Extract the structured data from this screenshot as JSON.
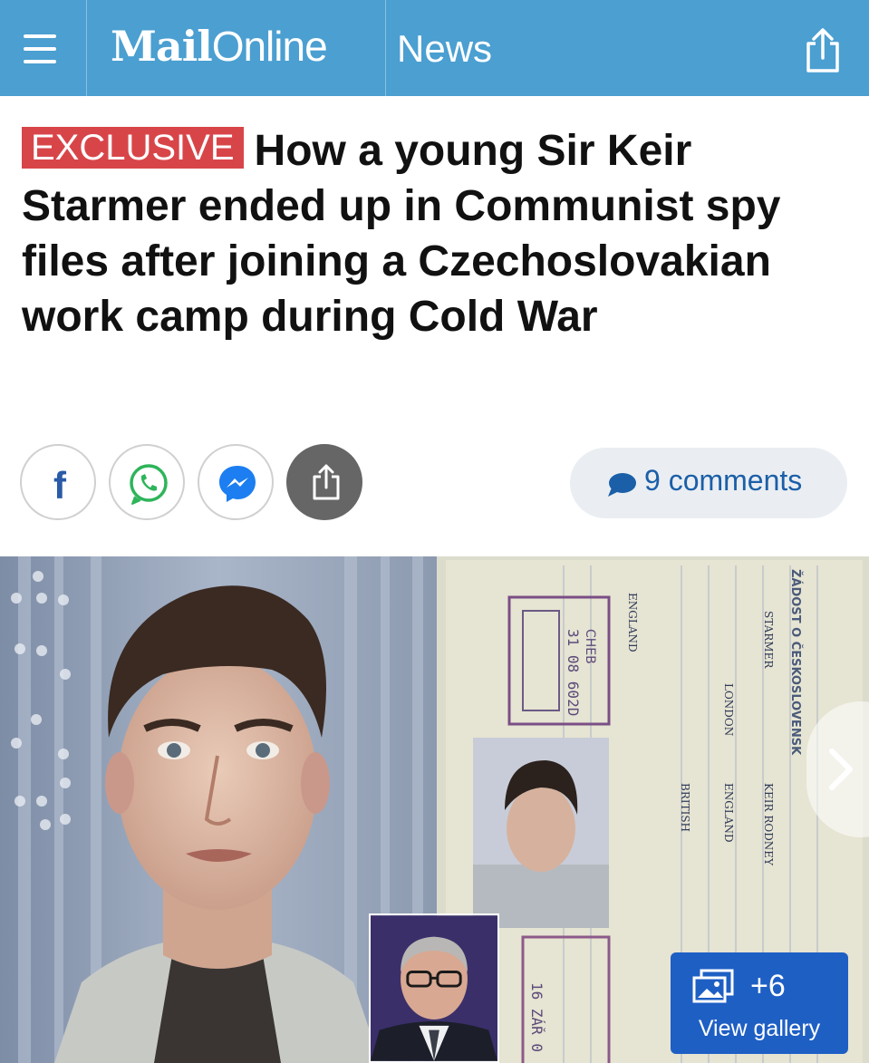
{
  "header": {
    "logo_mail": "Mail",
    "logo_online": "Online",
    "section": "News",
    "background_color": "#4b9fd1"
  },
  "article": {
    "badge": "EXCLUSIVE",
    "badge_color": "#d84549",
    "headline": "How a young Sir Keir Starmer ended up in Communist spy files after joining a Czechoslovakian work camp during Cold War"
  },
  "social": {
    "buttons": [
      {
        "icon": "facebook-icon"
      },
      {
        "icon": "whatsapp-icon"
      },
      {
        "icon": "messenger-icon"
      },
      {
        "icon": "share-icon"
      }
    ],
    "comments_label": "9 comments"
  },
  "gallery": {
    "extra_count": "+6",
    "view_label": "View gallery",
    "document_heading": "ŽÁDOST O ČESKOSLOVENSK",
    "document_stamp": "CHEB",
    "document_number": "31 08 602D",
    "document_stamp_bottom": "16 ZÁŘ 0",
    "document_fields": [
      "STARMER",
      "KEIR RODNEY",
      "LONDON",
      "ENGLAND",
      "BRITISH",
      "ENGLAND"
    ],
    "button_color": "#1e5fc4"
  }
}
